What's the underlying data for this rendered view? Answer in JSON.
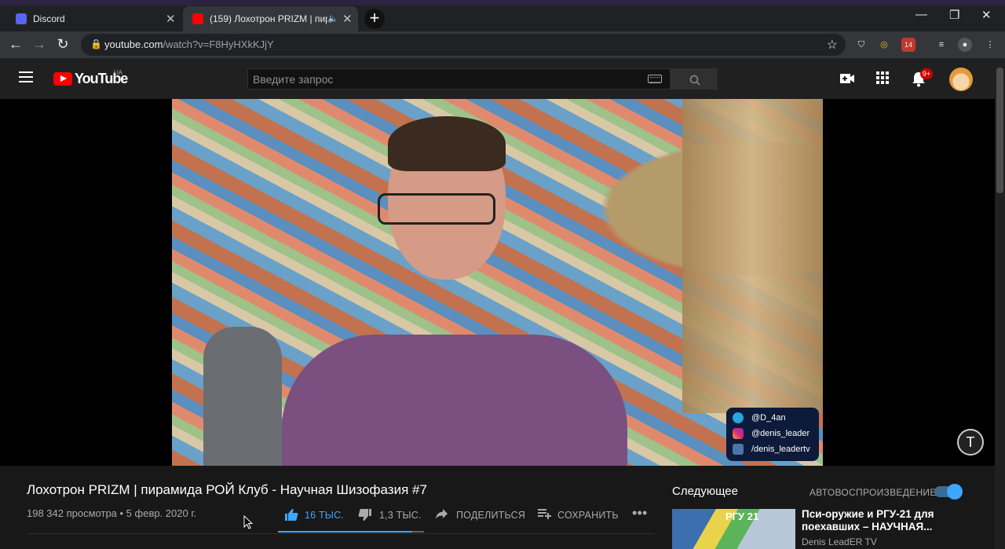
{
  "browser": {
    "tabs": [
      {
        "title": "Discord",
        "active": false
      },
      {
        "title": "(159) Лохотрон PRIZM | пир",
        "active": true
      }
    ],
    "url_host": "youtube.com",
    "url_path": "/watch?v=F8HyHXkKJjY",
    "extension_badge": "14"
  },
  "youtube": {
    "logo": "YouTube",
    "country": "UA",
    "search_placeholder": "Введите запрос",
    "notifications_badge": "9+"
  },
  "video": {
    "social": [
      {
        "network": "telegram-icon",
        "handle": "@D_4an"
      },
      {
        "network": "instagram-icon",
        "handle": "@denis_leader"
      },
      {
        "network": "vk-icon",
        "handle": "/denis_leadertv"
      }
    ],
    "title": "Лохотрон PRIZM | пирамида РОЙ Клуб - Научная Шизофазия #7",
    "views_date": "198 342 просмотра • 5 февр. 2020 г.",
    "likes": "16 ТЫС.",
    "dislikes": "1,3 ТЫС.",
    "share_label": "ПОДЕЛИТЬСЯ",
    "save_label": "СОХРАНИТЬ",
    "like_ratio": 0.92
  },
  "sidebar": {
    "up_next_label": "Следующее",
    "autoplay_label": "АВТОВОСПРОИЗВЕДЕНИЕ",
    "autoplay_on": true,
    "next_video": {
      "thumb_caption": "РГУ 21",
      "title": "Пси-оружие и РГУ-21 для поехавших – НАУЧНАЯ...",
      "channel": "Denis LeadER TV"
    }
  },
  "colors": {
    "accent": "#3ea6ff",
    "brand_red": "#ff0000",
    "background": "#181818"
  }
}
